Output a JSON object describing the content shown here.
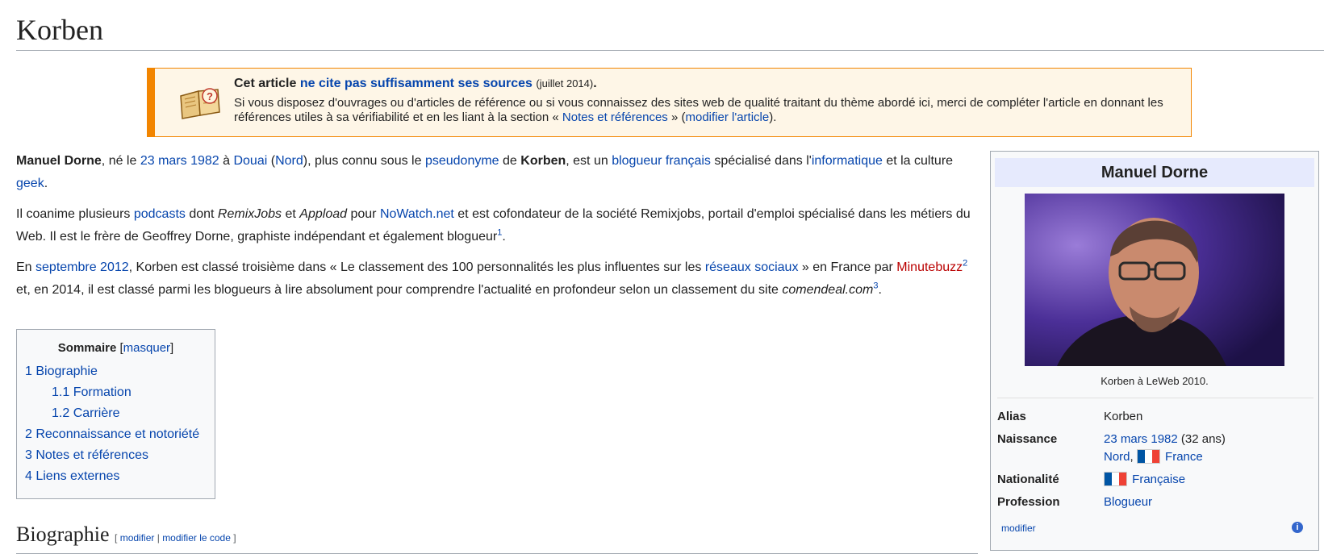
{
  "page": {
    "title": "Korben"
  },
  "banner": {
    "lead": "Cet article",
    "link": "ne cite pas suffisamment ses sources",
    "date": "(juillet 2014)",
    "dot": ".",
    "body_start": "Si vous disposez d'ouvrages ou d'articles de référence ou si vous connaissez des sites web de qualité traitant du thème abordé ici, merci de compléter l'article en donnant les références utiles à sa vérifiabilité et en les liant à la section «",
    "notes_link": "Notes et références",
    "body_mid": "» (",
    "modify_link": "modifier l'article",
    "body_end": ")."
  },
  "p1": {
    "name": "Manuel Dorne",
    "t1": ", né le ",
    "date_link": "23 mars 1982",
    "t2": " à ",
    "douai": "Douai",
    "t3": " (",
    "nord": "Nord",
    "t4": "), plus connu sous le ",
    "pseudo": "pseudonyme",
    "t5": " de ",
    "korben": "Korben",
    "t6": ", est un ",
    "blogueur": "blogueur français",
    "t7": " spécialisé dans l'",
    "info": "informatique",
    "t8": " et la culture ",
    "geek": "geek",
    "t9": "."
  },
  "p2": {
    "t1": "Il coanime plusieurs ",
    "podcasts": "podcasts",
    "t2": " dont ",
    "remix": "RemixJobs",
    "t3": " et ",
    "appload": "Appload",
    "t4": " pour ",
    "nowatch": "NoWatch.net",
    "t5": " et est cofondateur de la société Remixjobs, portail d'emploi spécialisé dans les métiers du Web. Il est le frère de Geoffrey Dorne, graphiste indépendant et également blogueur",
    "ref": "1",
    "t6": "."
  },
  "p3": {
    "t1": "En ",
    "sept": "septembre 2012",
    "t2": ", Korben est classé troisième dans « Le classement des 100 personnalités les plus influentes sur les ",
    "reseaux": "réseaux sociaux",
    "t3": " » en France par ",
    "minute": "Minutebuzz",
    "ref2": "2",
    "t4": " et, en 2014, il est classé parmi les blogueurs à lire absolument pour comprendre l'actualité en profondeur selon un classement du site ",
    "comendeal": "comendeal.com",
    "ref3": "3",
    "t5": "."
  },
  "toc": {
    "title": "Sommaire",
    "bracket_open": "[",
    "hide": "masquer",
    "bracket_close": "]",
    "items": [
      {
        "label": "1 Biographie"
      },
      {
        "label": "1.1 Formation"
      },
      {
        "label": "1.2 Carrière"
      },
      {
        "label": "2 Reconnaissance et notoriété"
      },
      {
        "label": "3 Notes et références"
      },
      {
        "label": "4 Liens externes"
      }
    ]
  },
  "section": {
    "title": "Biographie",
    "edit_open": "[ ",
    "edit1": "modifier",
    "edit_sep": " | ",
    "edit2": "modifier le code",
    "edit_close": " ]"
  },
  "infobox": {
    "title": "Manuel Dorne",
    "caption": "Korben à LeWeb 2010.",
    "alias_k": "Alias",
    "alias_v": "Korben",
    "naissance_k": "Naissance",
    "naissance_date": "23 mars 1982",
    "naissance_age": " (32 ans)",
    "naissance_nord": "Nord",
    "naissance_comma": ", ",
    "naissance_france": "France",
    "nationalite_k": "Nationalité",
    "nationalite_v": "Française",
    "profession_k": "Profession",
    "profession_v": "Blogueur",
    "modifier": "modifier",
    "info_glyph": "i",
    "flag_colors": [
      "#0055a4",
      "#ffffff",
      "#ef4135"
    ]
  }
}
